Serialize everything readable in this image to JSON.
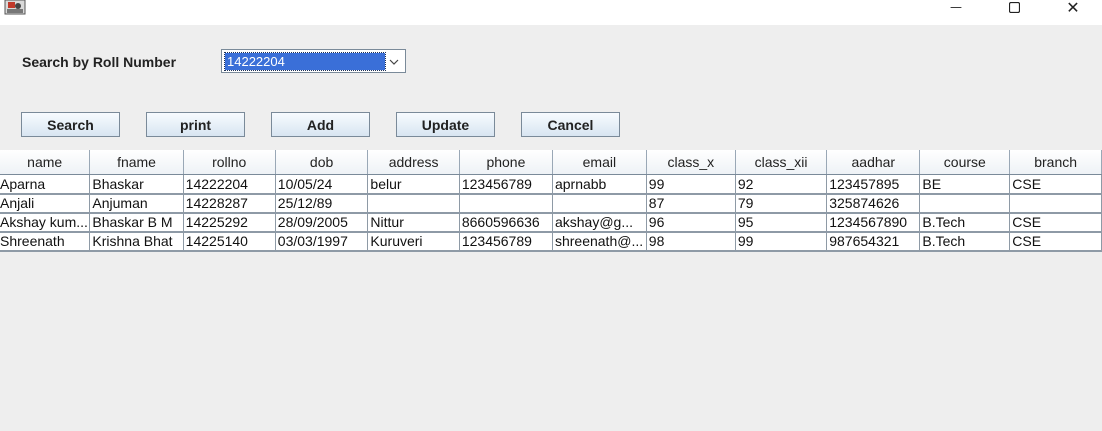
{
  "window": {
    "minimize_glyph": "—",
    "close_glyph": "✕"
  },
  "search": {
    "label": "Search by Roll Number",
    "selected_value": "14222204"
  },
  "buttons": {
    "search": "Search",
    "print": "print",
    "add": "Add",
    "update": "Update",
    "cancel": "Cancel"
  },
  "table": {
    "columns": [
      "name",
      "fname",
      "rollno",
      "dob",
      "address",
      "phone",
      "email",
      "class_x",
      "class_xii",
      "aadhar",
      "course",
      "branch"
    ],
    "rows": [
      [
        "Aparna",
        "Bhaskar",
        "14222204",
        "10/05/24",
        "belur",
        "123456789",
        "aprnabb",
        "99",
        "92",
        "123457895",
        "BE",
        "CSE"
      ],
      [
        "Anjali",
        "Anjuman",
        "14228287",
        "25/12/89",
        "",
        "",
        "",
        "87",
        "79",
        "325874626",
        "",
        ""
      ],
      [
        "Akshay kum...",
        "Bhaskar B M",
        "14225292",
        "28/09/2005",
        "Nittur",
        "8660596636",
        "akshay@g...",
        "96",
        "95",
        "1234567890",
        "B.Tech",
        "CSE"
      ],
      [
        "Shreenath",
        "Krishna Bhat",
        "14225140",
        "03/03/1997",
        "Kuruveri",
        "123456789",
        "shreenath@...",
        "98",
        "99",
        "987654321",
        "B.Tech",
        "CSE"
      ]
    ]
  }
}
